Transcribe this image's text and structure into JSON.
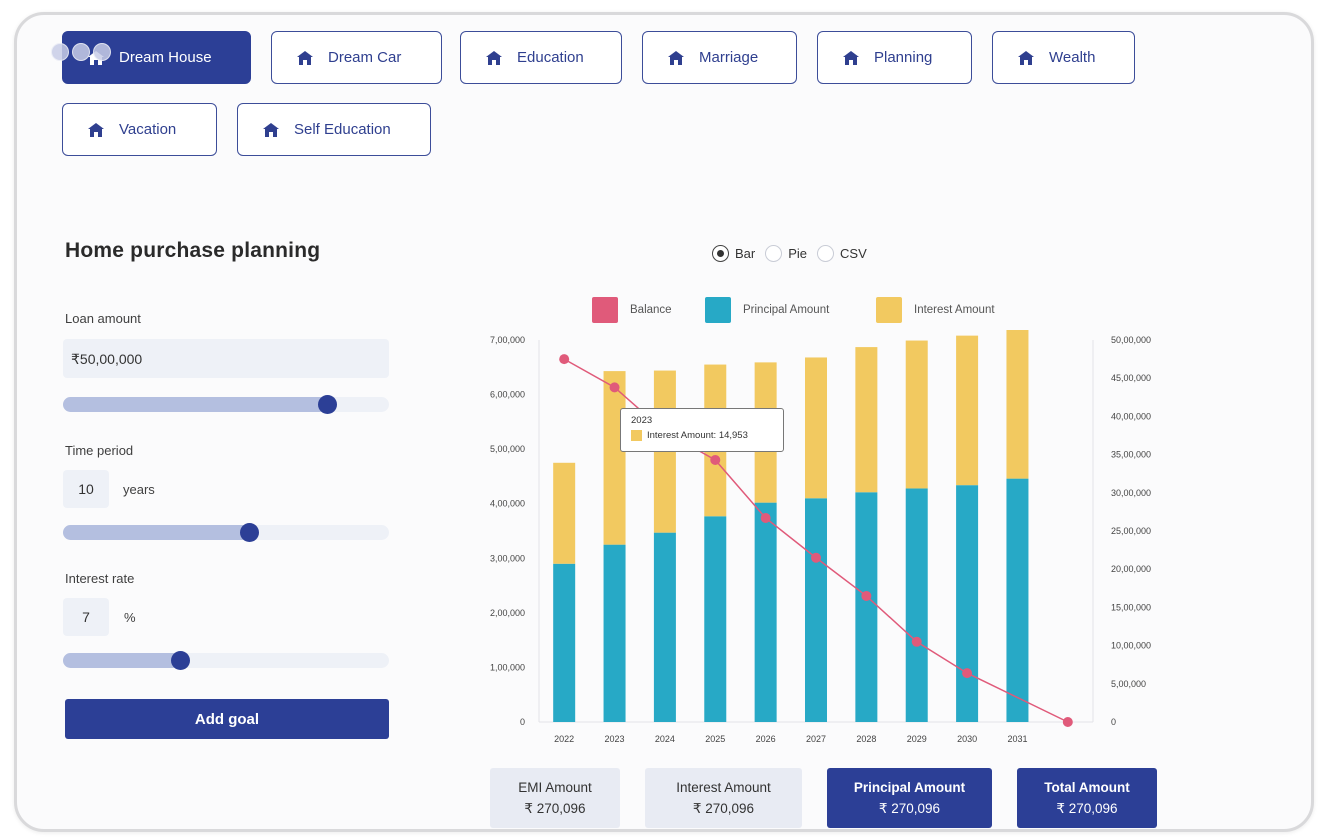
{
  "tabs": [
    {
      "label": "Dream House",
      "active": true
    },
    {
      "label": "Dream Car",
      "active": false
    },
    {
      "label": "Education",
      "active": false
    },
    {
      "label": "Marriage",
      "active": false
    },
    {
      "label": "Planning",
      "active": false
    },
    {
      "label": "Wealth",
      "active": false
    },
    {
      "label": "Vacation",
      "active": false
    },
    {
      "label": "Self Education",
      "active": false
    }
  ],
  "form": {
    "title": "Home purchase planning",
    "loan_label": "Loan amount",
    "loan_value": "₹50,00,000",
    "loan_slider_fraction": 0.81,
    "time_label": "Time period",
    "time_value": "10",
    "time_unit": "years",
    "time_slider_fraction": 0.57,
    "rate_label": "Interest rate",
    "rate_value": "7",
    "rate_unit": "%",
    "rate_slider_fraction": 0.36,
    "add_button": "Add goal"
  },
  "view_toggle": {
    "options": [
      "Bar",
      "Pie",
      "CSV"
    ],
    "selected": "Bar"
  },
  "legend": [
    {
      "label": "Balance",
      "color": "#e05a7a"
    },
    {
      "label": "Principal Amount",
      "color": "#27a9c6"
    },
    {
      "label": "Interest Amount",
      "color": "#f2c960"
    }
  ],
  "tooltip": {
    "year": "2023",
    "text": "Interest Amount: 14,953"
  },
  "chart_data": {
    "type": "bar",
    "stacked": true,
    "categories": [
      "2022",
      "2023",
      "2024",
      "2025",
      "2026",
      "2027",
      "2028",
      "2029",
      "2030",
      "2031",
      ""
    ],
    "series": [
      {
        "name": "Principal Amount",
        "color": "#27a9c6",
        "axis": "left",
        "values": [
          290000,
          325000,
          347000,
          377000,
          402000,
          410000,
          421000,
          428000,
          434000,
          446000
        ]
      },
      {
        "name": "Interest Amount",
        "color": "#f2c960",
        "axis": "left",
        "values": [
          185000,
          318000,
          297000,
          278000,
          257000,
          258000,
          266000,
          271000,
          274000,
          281000
        ]
      },
      {
        "name": "Balance",
        "color": "#e05a7a",
        "type": "line",
        "axis": "right",
        "values": [
          4750000,
          4380000,
          3800000,
          3430000,
          2670000,
          2150000,
          1650000,
          1050000,
          640000,
          0
        ]
      }
    ],
    "yleft_ticks": [
      "7,00,000",
      "6,00,000",
      "5,00,000",
      "4,00,000",
      "3,00,000",
      "2,00,000",
      "1,00,000",
      "0"
    ],
    "yleft_range": [
      0,
      700000
    ],
    "yright_ticks": [
      "50,00,000",
      "45,00,000",
      "40,00,000",
      "35,00,000",
      "30,00,000",
      "25,00,000",
      "20,00,000",
      "15,00,000",
      "10,00,000",
      "5,00,000",
      "0"
    ],
    "yright_range": [
      0,
      5000000
    ],
    "grid": false,
    "legend_position": "top"
  },
  "cards": [
    {
      "title": "EMI Amount",
      "value": "₹ 270,096",
      "style": "light"
    },
    {
      "title": "Interest Amount",
      "value": "₹ 270,096",
      "style": "light"
    },
    {
      "title": "Principal Amount",
      "value": "₹ 270,096",
      "style": "dark"
    },
    {
      "title": "Total Amount",
      "value": "₹ 270,096",
      "style": "dark"
    }
  ]
}
